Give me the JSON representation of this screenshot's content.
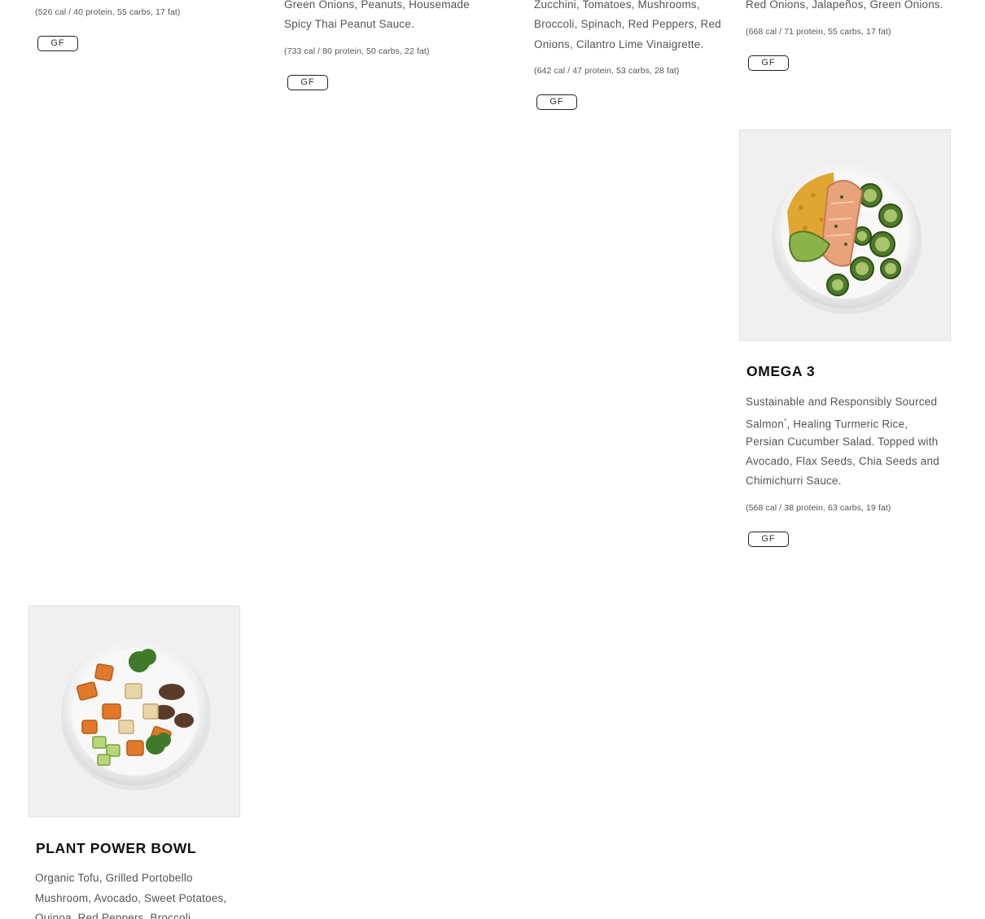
{
  "cards": {
    "c1": {
      "nutrition": "(526 cal / 40 protein, 55 carbs, 17 fat)",
      "tag": "GF"
    },
    "c2": {
      "desc_line1": "Green Onions, Peanuts, Housemade",
      "desc_line2": "Spicy Thai Peanut Sauce.",
      "nutrition": "(733 cal / 80 protein, 50 carbs, 22 fat)",
      "tag": "GF"
    },
    "c3": {
      "desc_line1": "Zucchini, Tomatoes, Mushrooms,",
      "desc_line2": "Broccoli, Spinach, Red Peppers, Red",
      "desc_line3": "Onions, Cilantro Lime Vinaigrette.",
      "nutrition": "(642 cal / 47 protein, 53 carbs, 28 fat)",
      "tag": "GF"
    },
    "c4": {
      "desc_line1": "Red Onions, Jalapeños, Green Onions.",
      "nutrition": "(668 cal / 71 protein, 55 carbs, 17 fat)",
      "tag": "GF"
    },
    "omega3": {
      "title": "OMEGA 3",
      "desc_line1": "Sustainable and Responsibly Sourced",
      "desc_line2a": "Salmon",
      "desc_sup": "*",
      "desc_line2b": ", Healing Turmeric Rice,",
      "desc_line3": "Persian Cucumber Salad. Topped with",
      "desc_line4": "Avocado, Flax Seeds, Chia Seeds and",
      "desc_line5": "Chimichurri Sauce.",
      "nutrition": "(568 cal / 38 protein, 63 carbs, 19 fat)",
      "tag": "GF"
    },
    "plant": {
      "title": "PLANT POWER BOWL",
      "desc_line1": "Organic Tofu, Grilled Portobello",
      "desc_line2": "Mushroom, Avocado, Sweet Potatoes,",
      "desc_line3": "Quinoa, Red Peppers, Broccoli,"
    }
  },
  "icons": {
    "omega_photo": "salmon-bowl-image",
    "plant_photo": "plant-power-bowl-image"
  }
}
